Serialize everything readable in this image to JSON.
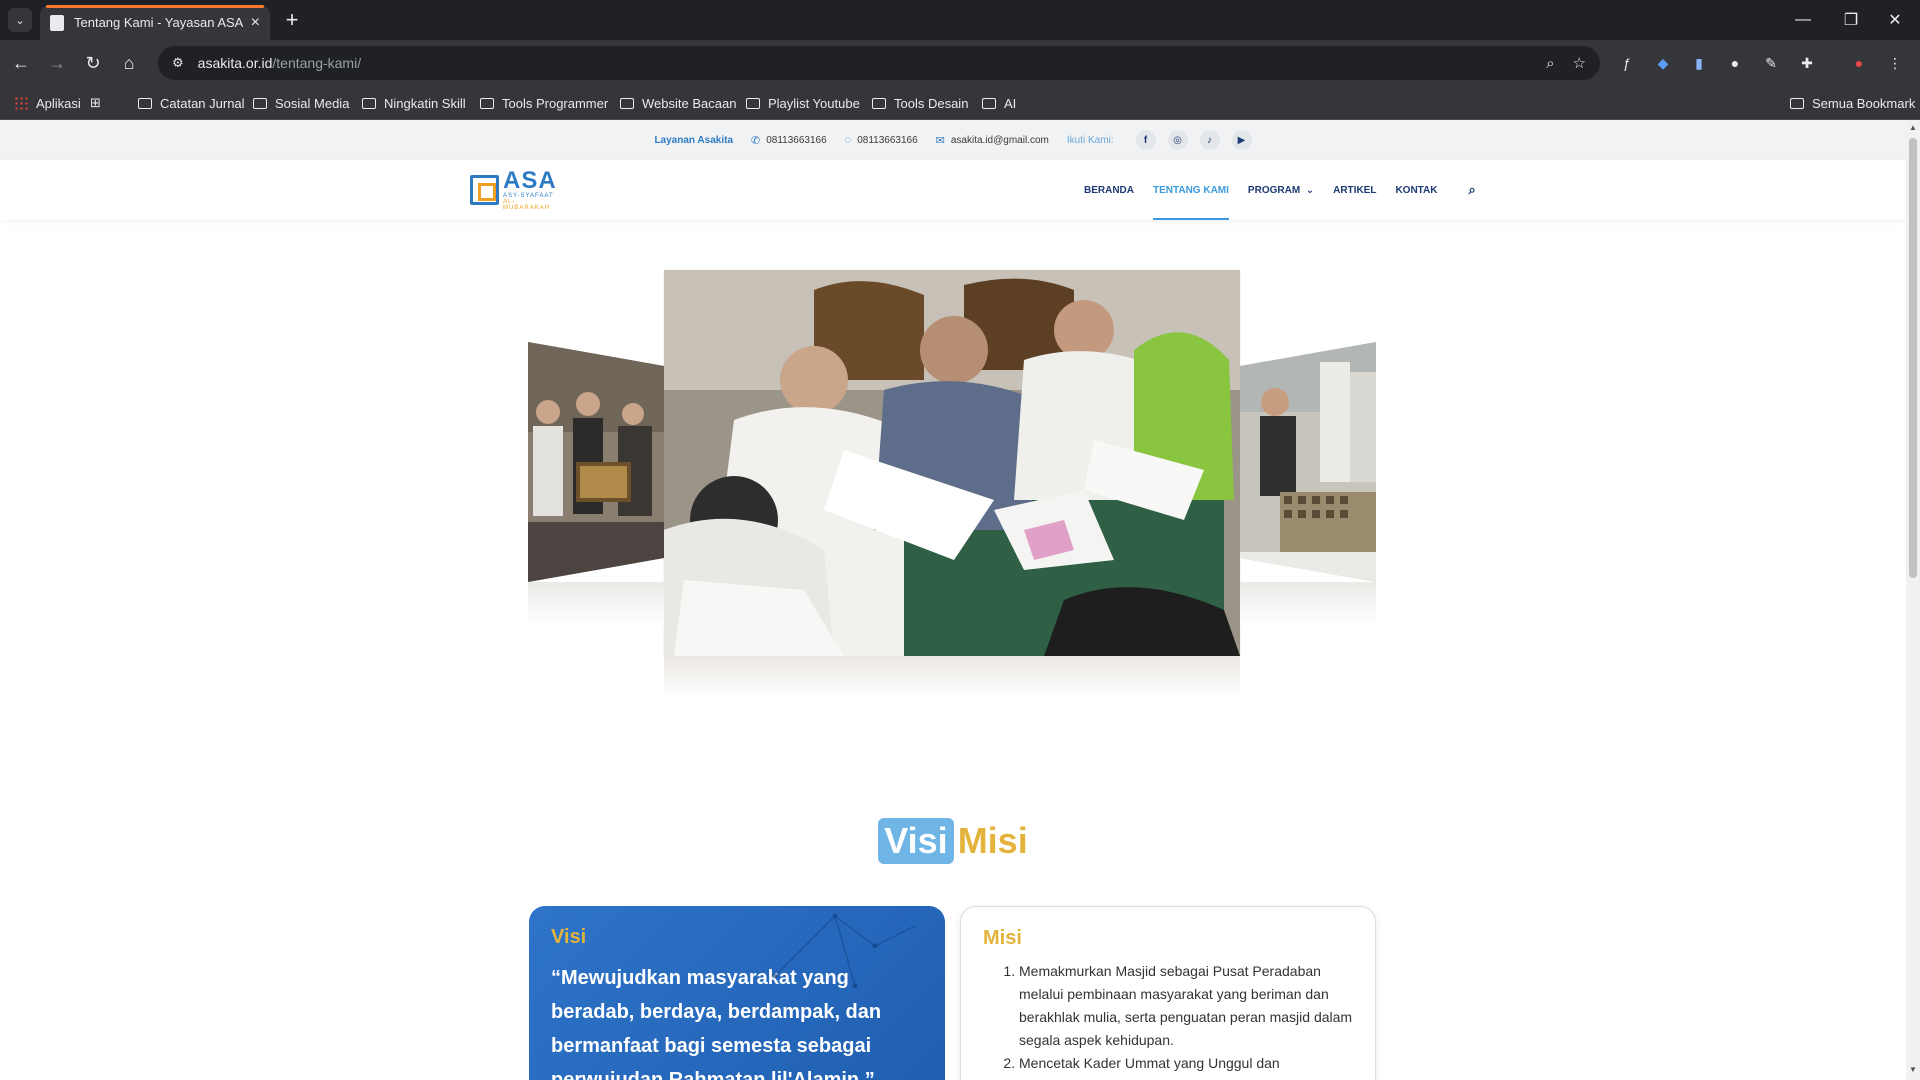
{
  "browser": {
    "tab_title": "Tentang Kami - Yayasan ASA KI",
    "url_host": "asakita.or.id",
    "url_path": "/tentang-kami/",
    "bookmarks": [
      "Aplikasi",
      "Catatan Jurnal",
      "Sosial Media",
      "Ningkatin Skill",
      "Tools Programmer",
      "Website Bacaan",
      "Playlist Youtube",
      "Tools Desain",
      "AI"
    ],
    "all_bookmarks": "Semua Bookmark"
  },
  "topbar": {
    "brand": "Layanan Asakita",
    "phone": "08113663166",
    "whatsapp": "08113663166",
    "email": "asakita.id@gmail.com",
    "follow": "Ikuti Kami:",
    "social": [
      "f",
      "◎",
      "♪",
      "▶"
    ]
  },
  "logo": {
    "name": "ASA",
    "line1": "ASY-SYAFAAT",
    "line2": "AL-MUBARAKAH"
  },
  "nav": {
    "items": [
      "BERANDA",
      "TENTANG KAMI",
      "PROGRAM",
      "ARTIKEL",
      "KONTAK"
    ],
    "active_index": 1
  },
  "visimisi": {
    "title_visi": "Visi",
    "title_misi": "Misi",
    "visi_heading": "Visi",
    "visi_text": "“Mewujudkan masyarakat yang beradab, berdaya, berdampak, dan bermanfaat bagi semesta sebagai perwujudan Rahmatan lil'Alamin.”",
    "misi_heading": "Misi",
    "misi_items": [
      "Memakmurkan Masjid sebagai Pusat Peradaban melalui pembinaan masyarakat yang beriman dan berakhlak mulia, serta penguatan peran masjid dalam segala aspek kehidupan.",
      "Mencetak Kader Ummat yang Unggul dan"
    ]
  },
  "colors": {
    "accent_blue": "#2e74c9",
    "accent_gold": "#e3b33c",
    "nav_active": "#3a9be0"
  }
}
